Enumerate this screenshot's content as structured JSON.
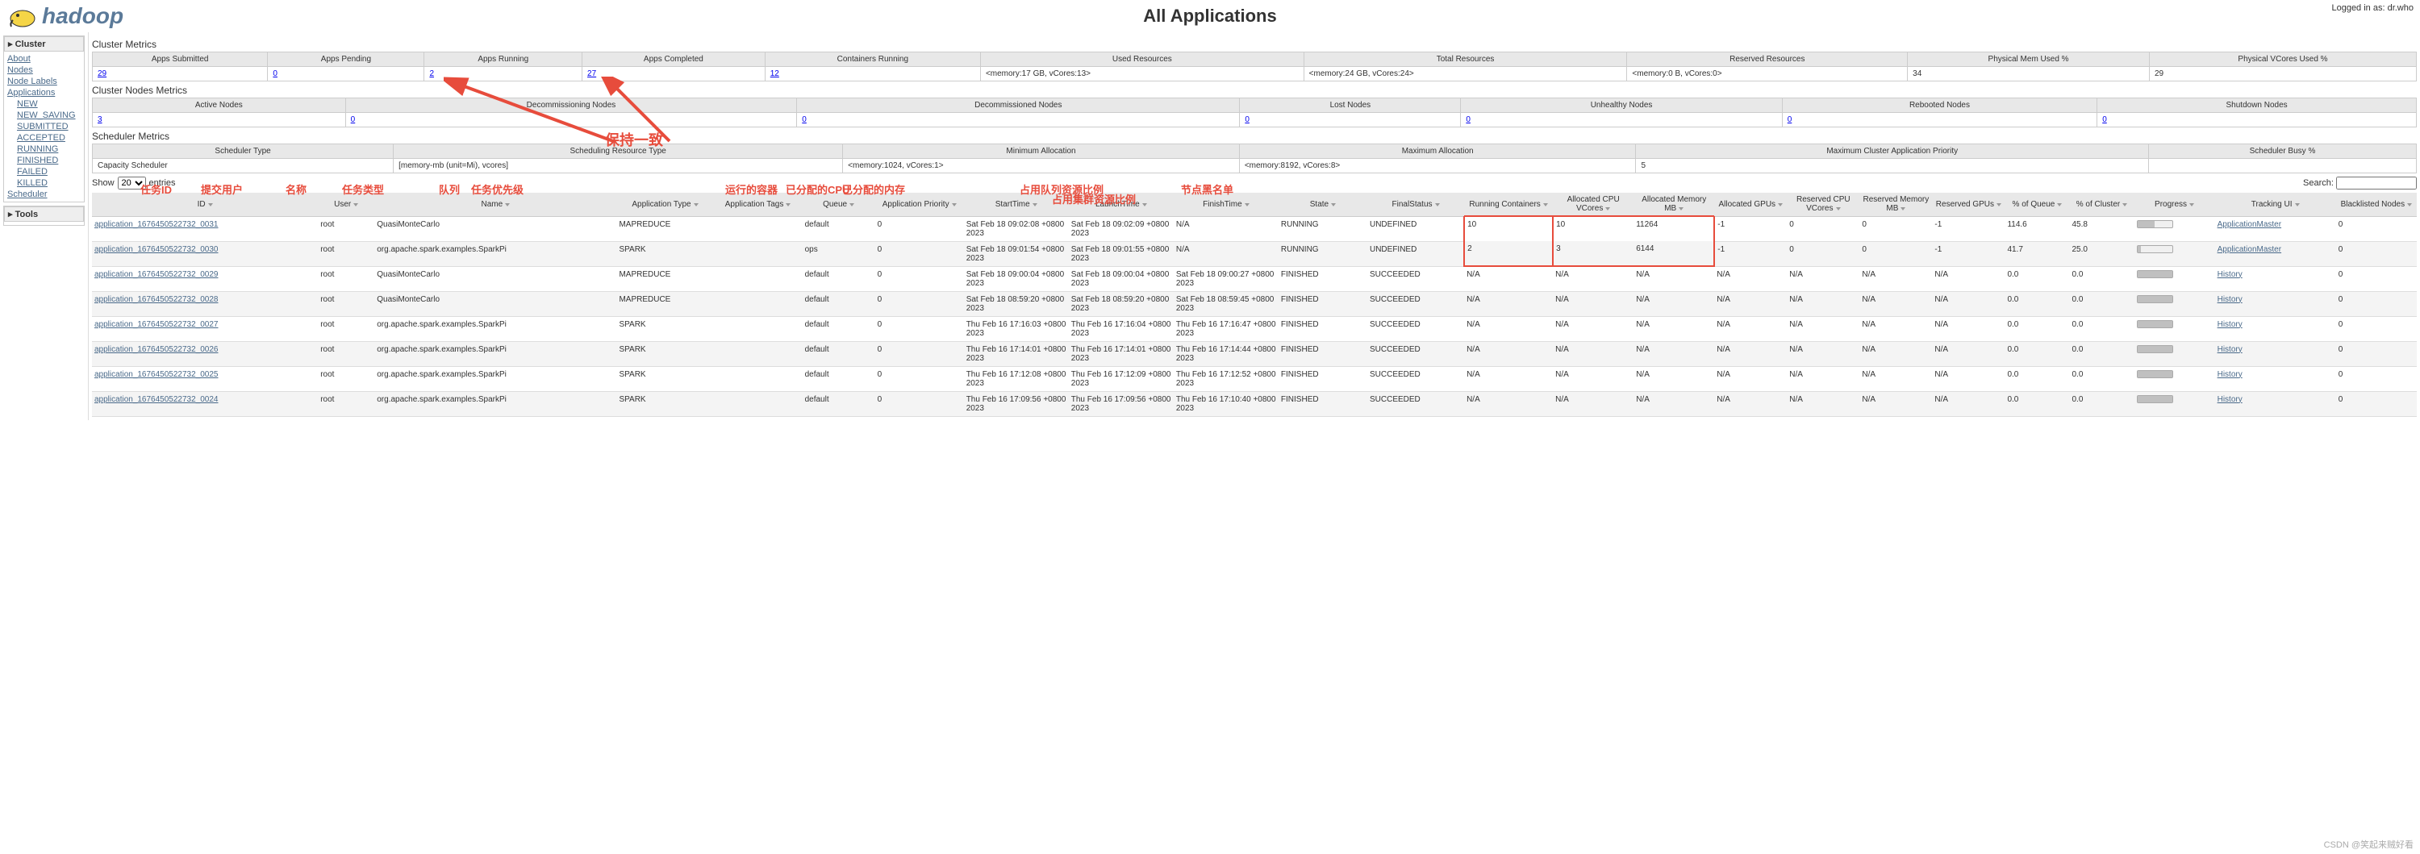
{
  "login_text": "Logged in as: dr.who",
  "page_title": "All Applications",
  "logo_text": "hadoop",
  "sidebar": {
    "cluster_header": "Cluster",
    "links": [
      "About",
      "Nodes",
      "Node Labels",
      "Applications"
    ],
    "app_states": [
      "NEW",
      "NEW_SAVING",
      "SUBMITTED",
      "ACCEPTED",
      "RUNNING",
      "FINISHED",
      "FAILED",
      "KILLED"
    ],
    "scheduler": "Scheduler",
    "tools_header": "Tools"
  },
  "cluster_metrics": {
    "title": "Cluster Metrics",
    "headers": [
      "Apps Submitted",
      "Apps Pending",
      "Apps Running",
      "Apps Completed",
      "Containers Running",
      "Used Resources",
      "Total Resources",
      "Reserved Resources",
      "Physical Mem Used %",
      "Physical VCores Used %"
    ],
    "values": [
      "29",
      "0",
      "2",
      "27",
      "12",
      "<memory:17 GB, vCores:13>",
      "<memory:24 GB, vCores:24>",
      "<memory:0 B, vCores:0>",
      "34",
      "29"
    ]
  },
  "nodes_metrics": {
    "title": "Cluster Nodes Metrics",
    "headers": [
      "Active Nodes",
      "Decommissioning Nodes",
      "Decommissioned Nodes",
      "Lost Nodes",
      "Unhealthy Nodes",
      "Rebooted Nodes",
      "Shutdown Nodes"
    ],
    "values": [
      "3",
      "0",
      "0",
      "0",
      "0",
      "0",
      "0"
    ]
  },
  "scheduler_metrics": {
    "title": "Scheduler Metrics",
    "headers": [
      "Scheduler Type",
      "Scheduling Resource Type",
      "Minimum Allocation",
      "Maximum Allocation",
      "Maximum Cluster Application Priority",
      "Scheduler Busy %"
    ],
    "values": [
      "Capacity Scheduler",
      "[memory-mb (unit=Mi), vcores]",
      "<memory:1024, vCores:1>",
      "<memory:8192, vCores:8>",
      "5",
      ""
    ]
  },
  "show_label": "Show",
  "entries_label": "entries",
  "entries_val": "20",
  "search_label": "Search:",
  "columns": [
    "ID",
    "User",
    "Name",
    "Application Type",
    "Application Tags",
    "Queue",
    "Application Priority",
    "StartTime",
    "LaunchTime",
    "FinishTime",
    "State",
    "FinalStatus",
    "Running Containers",
    "Allocated CPU VCores",
    "Allocated Memory MB",
    "Allocated GPUs",
    "Reserved CPU VCores",
    "Reserved Memory MB",
    "Reserved GPUs",
    "% of Queue",
    "% of Cluster",
    "Progress",
    "Tracking UI",
    "Blacklisted Nodes"
  ],
  "annotations": {
    "id": "任务ID",
    "user": "提交用户",
    "name": "名称",
    "type": "任务类型",
    "queue": "队列",
    "priority": "任务优先级",
    "containers": "运行的容器",
    "cpu": "已分配的CPU",
    "mem": "已分配的内存",
    "queue_pct": "占用队列资源比例",
    "cluster_pct": "占用集群资源比例",
    "blacklist": "节点黑名单",
    "consistent": "保持一致"
  },
  "rows": [
    {
      "id": "application_1676450522732_0031",
      "user": "root",
      "name": "QuasiMonteCarlo",
      "type": "MAPREDUCE",
      "tags": "",
      "queue": "default",
      "priority": "0",
      "start": "Sat Feb 18 09:02:08 +0800 2023",
      "launch": "Sat Feb 18 09:02:09 +0800 2023",
      "finish": "N/A",
      "state": "RUNNING",
      "final": "UNDEFINED",
      "rc": "10",
      "cpu": "10",
      "mem": "11264",
      "gpu": "-1",
      "rcpu": "0",
      "rmem": "0",
      "rgpu": "-1",
      "pq": "114.6",
      "pc": "45.8",
      "progress": 50,
      "track": "ApplicationMaster",
      "bl": "0",
      "hl": true
    },
    {
      "id": "application_1676450522732_0030",
      "user": "root",
      "name": "org.apache.spark.examples.SparkPi",
      "type": "SPARK",
      "tags": "",
      "queue": "ops",
      "priority": "0",
      "start": "Sat Feb 18 09:01:54 +0800 2023",
      "launch": "Sat Feb 18 09:01:55 +0800 2023",
      "finish": "N/A",
      "state": "RUNNING",
      "final": "UNDEFINED",
      "rc": "2",
      "cpu": "3",
      "mem": "6144",
      "gpu": "-1",
      "rcpu": "0",
      "rmem": "0",
      "rgpu": "-1",
      "pq": "41.7",
      "pc": "25.0",
      "progress": 10,
      "track": "ApplicationMaster",
      "bl": "0",
      "hl": true
    },
    {
      "id": "application_1676450522732_0029",
      "user": "root",
      "name": "QuasiMonteCarlo",
      "type": "MAPREDUCE",
      "tags": "",
      "queue": "default",
      "priority": "0",
      "start": "Sat Feb 18 09:00:04 +0800 2023",
      "launch": "Sat Feb 18 09:00:04 +0800 2023",
      "finish": "Sat Feb 18 09:00:27 +0800 2023",
      "state": "FINISHED",
      "final": "SUCCEEDED",
      "rc": "N/A",
      "cpu": "N/A",
      "mem": "N/A",
      "gpu": "N/A",
      "rcpu": "N/A",
      "rmem": "N/A",
      "rgpu": "N/A",
      "pq": "0.0",
      "pc": "0.0",
      "progress": 100,
      "track": "History",
      "bl": "0"
    },
    {
      "id": "application_1676450522732_0028",
      "user": "root",
      "name": "QuasiMonteCarlo",
      "type": "MAPREDUCE",
      "tags": "",
      "queue": "default",
      "priority": "0",
      "start": "Sat Feb 18 08:59:20 +0800 2023",
      "launch": "Sat Feb 18 08:59:20 +0800 2023",
      "finish": "Sat Feb 18 08:59:45 +0800 2023",
      "state": "FINISHED",
      "final": "SUCCEEDED",
      "rc": "N/A",
      "cpu": "N/A",
      "mem": "N/A",
      "gpu": "N/A",
      "rcpu": "N/A",
      "rmem": "N/A",
      "rgpu": "N/A",
      "pq": "0.0",
      "pc": "0.0",
      "progress": 100,
      "track": "History",
      "bl": "0"
    },
    {
      "id": "application_1676450522732_0027",
      "user": "root",
      "name": "org.apache.spark.examples.SparkPi",
      "type": "SPARK",
      "tags": "",
      "queue": "default",
      "priority": "0",
      "start": "Thu Feb 16 17:16:03 +0800 2023",
      "launch": "Thu Feb 16 17:16:04 +0800 2023",
      "finish": "Thu Feb 16 17:16:47 +0800 2023",
      "state": "FINISHED",
      "final": "SUCCEEDED",
      "rc": "N/A",
      "cpu": "N/A",
      "mem": "N/A",
      "gpu": "N/A",
      "rcpu": "N/A",
      "rmem": "N/A",
      "rgpu": "N/A",
      "pq": "0.0",
      "pc": "0.0",
      "progress": 100,
      "track": "History",
      "bl": "0"
    },
    {
      "id": "application_1676450522732_0026",
      "user": "root",
      "name": "org.apache.spark.examples.SparkPi",
      "type": "SPARK",
      "tags": "",
      "queue": "default",
      "priority": "0",
      "start": "Thu Feb 16 17:14:01 +0800 2023",
      "launch": "Thu Feb 16 17:14:01 +0800 2023",
      "finish": "Thu Feb 16 17:14:44 +0800 2023",
      "state": "FINISHED",
      "final": "SUCCEEDED",
      "rc": "N/A",
      "cpu": "N/A",
      "mem": "N/A",
      "gpu": "N/A",
      "rcpu": "N/A",
      "rmem": "N/A",
      "rgpu": "N/A",
      "pq": "0.0",
      "pc": "0.0",
      "progress": 100,
      "track": "History",
      "bl": "0"
    },
    {
      "id": "application_1676450522732_0025",
      "user": "root",
      "name": "org.apache.spark.examples.SparkPi",
      "type": "SPARK",
      "tags": "",
      "queue": "default",
      "priority": "0",
      "start": "Thu Feb 16 17:12:08 +0800 2023",
      "launch": "Thu Feb 16 17:12:09 +0800 2023",
      "finish": "Thu Feb 16 17:12:52 +0800 2023",
      "state": "FINISHED",
      "final": "SUCCEEDED",
      "rc": "N/A",
      "cpu": "N/A",
      "mem": "N/A",
      "gpu": "N/A",
      "rcpu": "N/A",
      "rmem": "N/A",
      "rgpu": "N/A",
      "pq": "0.0",
      "pc": "0.0",
      "progress": 100,
      "track": "History",
      "bl": "0"
    },
    {
      "id": "application_1676450522732_0024",
      "user": "root",
      "name": "org.apache.spark.examples.SparkPi",
      "type": "SPARK",
      "tags": "",
      "queue": "default",
      "priority": "0",
      "start": "Thu Feb 16 17:09:56 +0800 2023",
      "launch": "Thu Feb 16 17:09:56 +0800 2023",
      "finish": "Thu Feb 16 17:10:40 +0800 2023",
      "state": "FINISHED",
      "final": "SUCCEEDED",
      "rc": "N/A",
      "cpu": "N/A",
      "mem": "N/A",
      "gpu": "N/A",
      "rcpu": "N/A",
      "rmem": "N/A",
      "rgpu": "N/A",
      "pq": "0.0",
      "pc": "0.0",
      "progress": 100,
      "track": "History",
      "bl": "0"
    }
  ],
  "watermark": "CSDN @笑起来贼好看"
}
